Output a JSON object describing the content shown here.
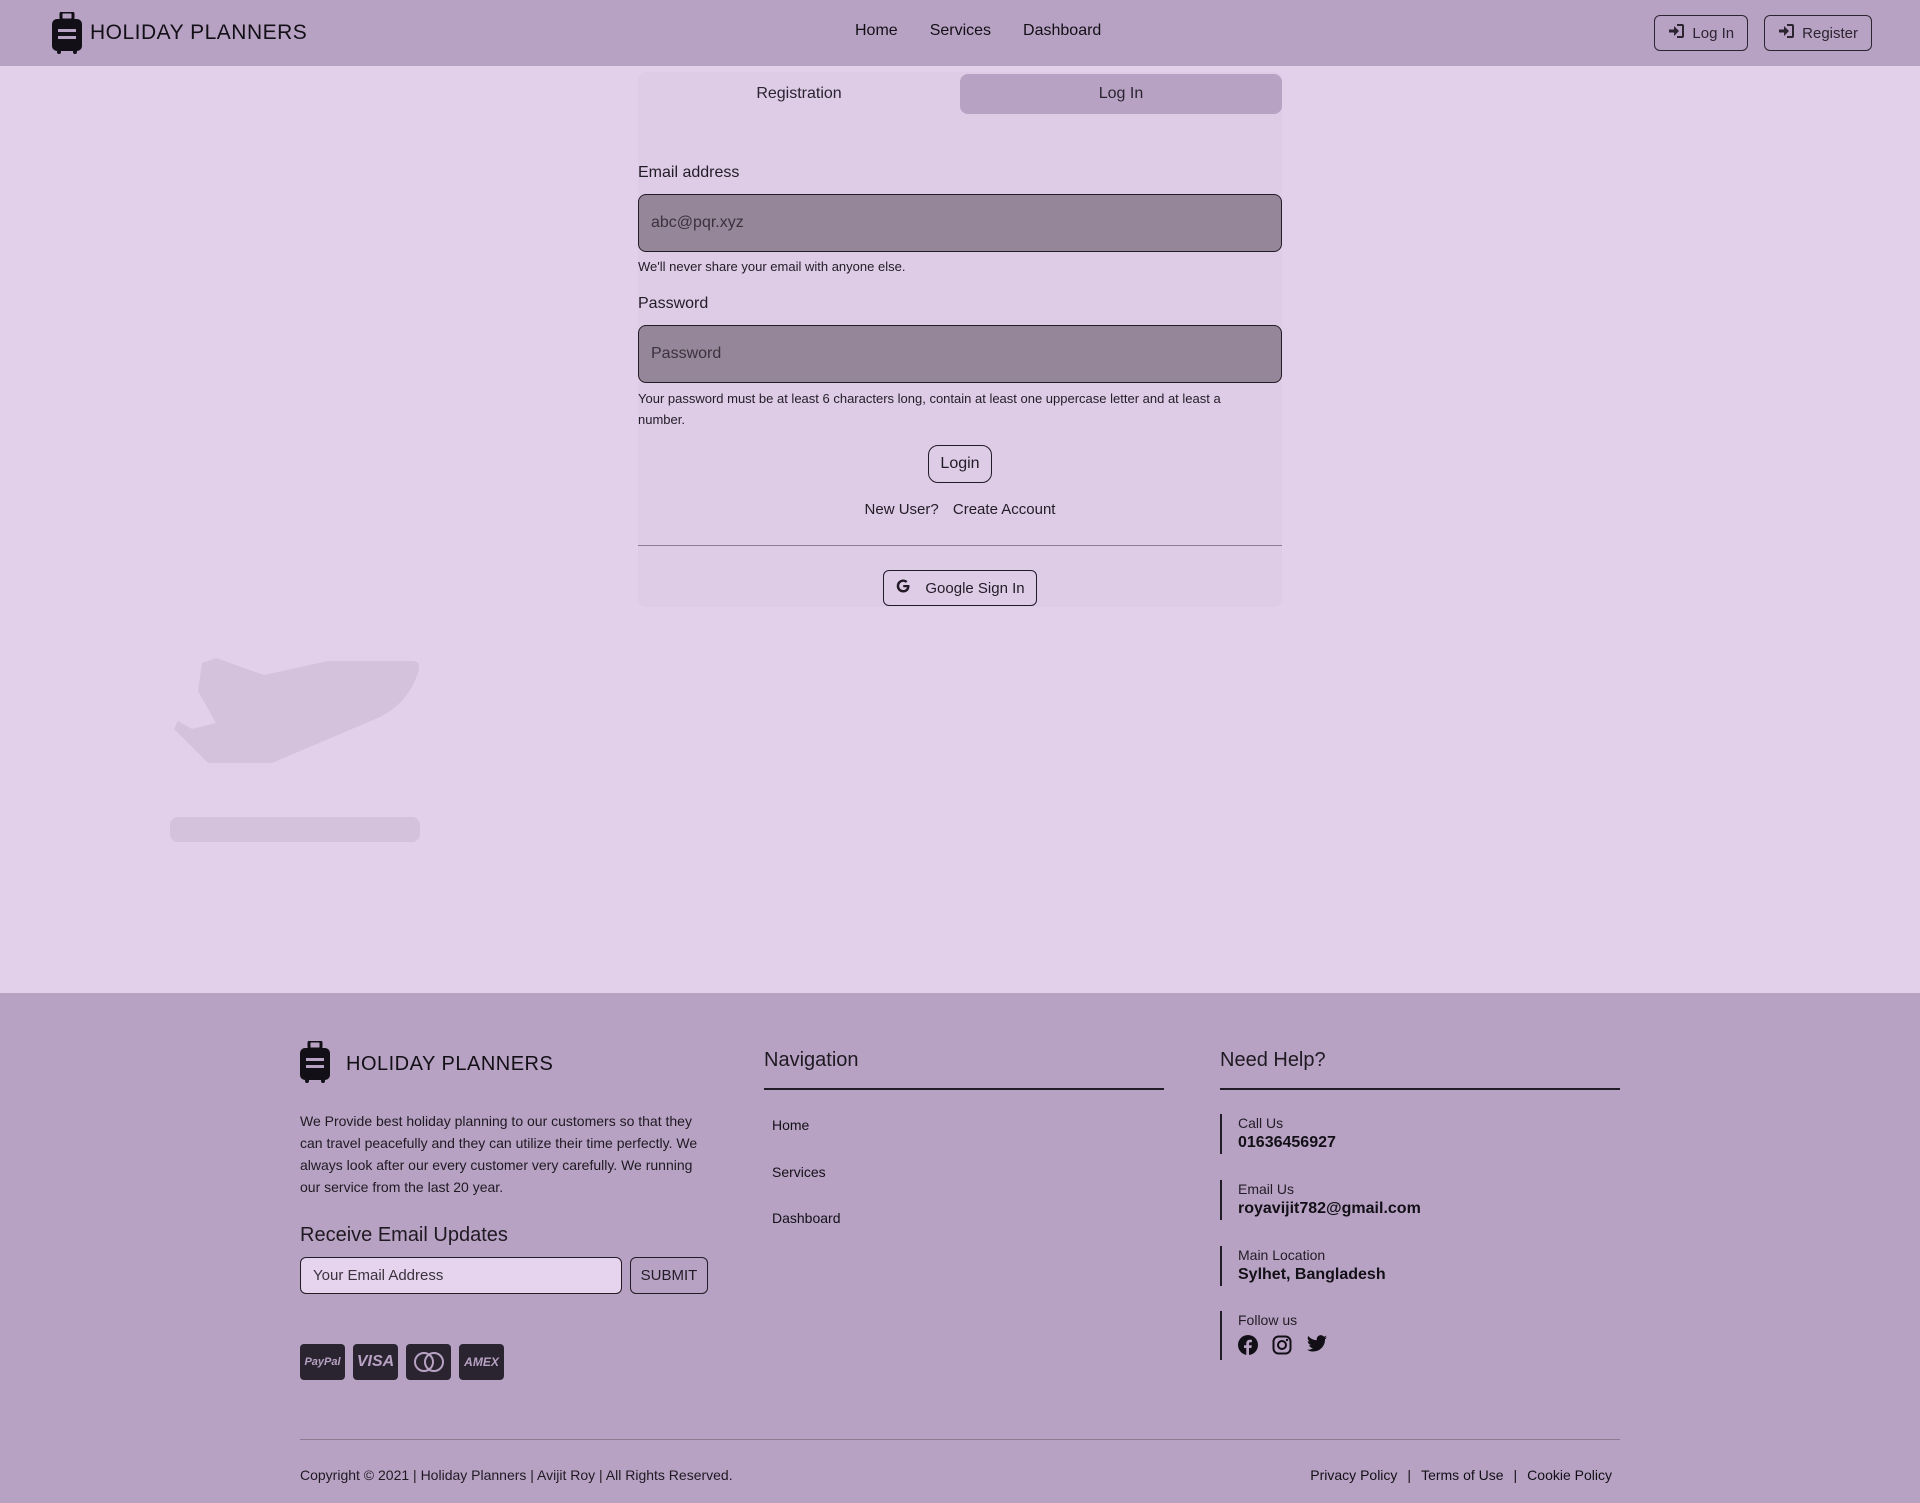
{
  "brand": {
    "name": "HOLIDAY PLANNERS"
  },
  "nav": {
    "links": [
      "Home",
      "Services",
      "Dashboard"
    ],
    "login": "Log In",
    "register": "Register"
  },
  "auth": {
    "tabs": {
      "registration": "Registration",
      "login": "Log In"
    },
    "active_tab": "Log In",
    "email_label": "Email address",
    "email_placeholder": "abc@pqr.xyz",
    "email_help": "We'll never share your email with anyone else.",
    "password_label": "Password",
    "password_placeholder": "Password",
    "password_help": "Your password must be at least 6 characters long, contain at least one uppercase letter and at least a number.",
    "login_button": "Login",
    "new_user": "New User?",
    "create_account": "Create Account",
    "google_button": "Google Sign In"
  },
  "footer": {
    "brand": "HOLIDAY PLANNERS",
    "about": "We Provide best holiday planning to our customers so that they can travel peacefully and they can utilize their time perfectly. We always look after our every customer very carefully. We running our service from the last 20 year.",
    "updates_title": "Receive Email Updates",
    "email_placeholder": "Your Email Address",
    "submit": "SUBMIT",
    "payment_cards": [
      "PayPal",
      "VISA",
      "mastercard",
      "AMEX"
    ],
    "navigation_title": "Navigation",
    "navigation": [
      "Home",
      "Services",
      "Dashboard"
    ],
    "help_title": "Need Help?",
    "help": {
      "call_label": "Call Us",
      "call_value": "01636456927",
      "email_label": "Email Us",
      "email_value": "royavijit782@gmail.com",
      "location_label": "Main Location",
      "location_value": "Sylhet, Bangladesh",
      "follow_label": "Follow us",
      "social_icons": [
        "facebook-icon",
        "instagram-icon",
        "twitter-icon"
      ]
    },
    "copyright": "Copyright © 2021 | Holiday Planners | Avijit Roy | All Rights Reserved.",
    "policies": [
      "Privacy Policy",
      "Terms of Use",
      "Cookie Policy"
    ]
  },
  "colors": {
    "page_bg": "#e2d0ea",
    "bar_bg": "#b8a2c4",
    "input_bg": "#968699",
    "card_bg": "#decbe6",
    "text": "#1f1a22"
  }
}
